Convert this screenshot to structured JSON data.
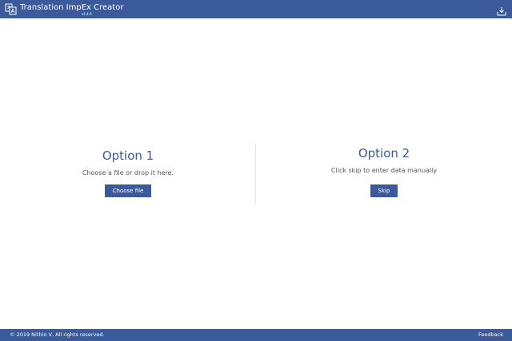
{
  "header": {
    "title": "Translation ImpEx Creator",
    "version": "v1.4.0",
    "app_icon": "translate-icon",
    "download_icon": "download-icon"
  },
  "option1": {
    "heading": "Option 1",
    "description": "Choose a file or drop it here.",
    "button_label": "Choose file"
  },
  "option2": {
    "heading": "Option 2",
    "description": "Click skip to enter data manually",
    "button_label": "Skip"
  },
  "footer": {
    "copyright": "© 2019 Nithin V, All rights reserved.",
    "feedback_label": "Feedback"
  },
  "colors": {
    "primary": "#3a5a9b",
    "background": "#ffffff",
    "text_muted": "#555555"
  }
}
